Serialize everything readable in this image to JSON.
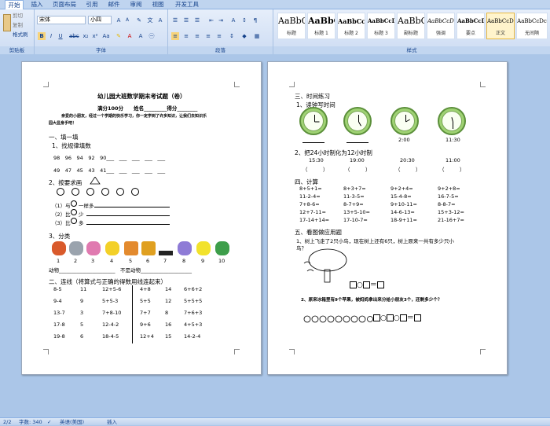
{
  "tabs": [
    "开始",
    "插入",
    "页面布局",
    "引用",
    "邮件",
    "审阅",
    "视图",
    "开发工具"
  ],
  "clipboard": {
    "cut": "剪切",
    "copy": "复制",
    "format_painter": "格式刷",
    "label": "剪贴板"
  },
  "font": {
    "name": "宋体",
    "size": "小四",
    "label": "字体"
  },
  "paragraph": {
    "label": "段落"
  },
  "styles": {
    "label": "样式",
    "items": [
      {
        "sample": "AaBbC",
        "name": "标题"
      },
      {
        "sample": "AaBbC",
        "name": "标题 1"
      },
      {
        "sample": "AaBbCcD",
        "name": "标题 2"
      },
      {
        "sample": "AaBbCcDd",
        "name": "标题 3"
      },
      {
        "sample": "AaBbC",
        "name": "副标题"
      },
      {
        "sample": "AaBbCcDe",
        "name": "强调"
      },
      {
        "sample": "AaBbCcDd",
        "name": "要点"
      },
      {
        "sample": "AaBbCcDc",
        "name": "正文"
      },
      {
        "sample": "AaBbCcDc",
        "name": "无间隔"
      }
    ]
  },
  "page1": {
    "title": "幼儿园大班数学期末考试题（卷）",
    "score_line": "满分100分　　姓名_________得分________",
    "intro1": "亲爱的小朋友，经过一个学期的快乐学习，你一定学到了许多知识，让我们去知识乐",
    "intro2": "园大显身手吧！",
    "s1": "一、填一填",
    "s1_1": "1、找规律填数",
    "seq1": "98　96　94　92　90___　___　___　___　___",
    "seq2": "49　47　45　43　41___　___　___　___　___",
    "s1_2": "2、按要求画",
    "cmp1": "（1）与",
    "cmp1b": "一样多",
    "cmp2": "（2）比",
    "cmp2b": "少",
    "cmp3": "（3）比",
    "cmp3b": "多",
    "s1_3": "3、分类",
    "nums": [
      "1",
      "2",
      "3",
      "4",
      "5",
      "6",
      "7",
      "8",
      "9",
      "10"
    ],
    "animals_line": "动物______________________　不是动物____________________",
    "s2": "二、连线（将算式与正确的得数用线连起来）",
    "rows": [
      [
        "8-5",
        "11",
        "12+5-6",
        "4+8",
        "14",
        "6+6+2"
      ],
      [
        "9-4",
        "9",
        "5+5-3",
        "5+5",
        "12",
        "5+5+5"
      ],
      [
        "13-7",
        "3",
        "7+8-10",
        "7+7",
        "8",
        "7+6+3"
      ],
      [
        "17-8",
        "5",
        "12-4-2",
        "9+6",
        "16",
        "4+5+3"
      ],
      [
        "19-8",
        "6",
        "18-4-5",
        "12+4",
        "15",
        "14-2-4"
      ]
    ]
  },
  "page2": {
    "s3": "三、时间练习",
    "s3_1": "1、读钟写时间",
    "clock_times": [
      "2:00",
      "11:30"
    ],
    "s3_2": "2、把24小时制化为12小时制",
    "times24": [
      "15:30",
      "19:00",
      "20:30",
      "11:00"
    ],
    "paren": "（　　　）",
    "s4": "四、计算",
    "calc": [
      [
        "8+5+1=",
        "8+3+7=",
        "9+2+4=",
        "9+2+8="
      ],
      [
        "11-2-4=",
        "11-3-5=",
        "15-4-8=",
        "16-7-5="
      ],
      [
        "7+8-6=",
        "8-7+9=",
        "9+10-11=",
        "8-8-7="
      ],
      [
        "12+7-11=",
        "13+5-10=",
        "14-6-13=",
        "15+3-12="
      ],
      [
        "17-14+14=",
        "17-10-7=",
        "18-9+11=",
        "21-16+7="
      ]
    ],
    "s5": "五、看图做应用题",
    "q1a": "1、树上飞走了2只小鸟，现在树上还有6只，树上原来一共有多少只小",
    "q1b": "鸟？",
    "q2": "2、原来冰箱里有9个苹果，被妈妈拿出来分给小朋友3个，还剩多少个？"
  },
  "status": {
    "page": "2/2",
    "words": "字数: 340",
    "lang": "英语(美国)",
    "mode": "插入"
  }
}
